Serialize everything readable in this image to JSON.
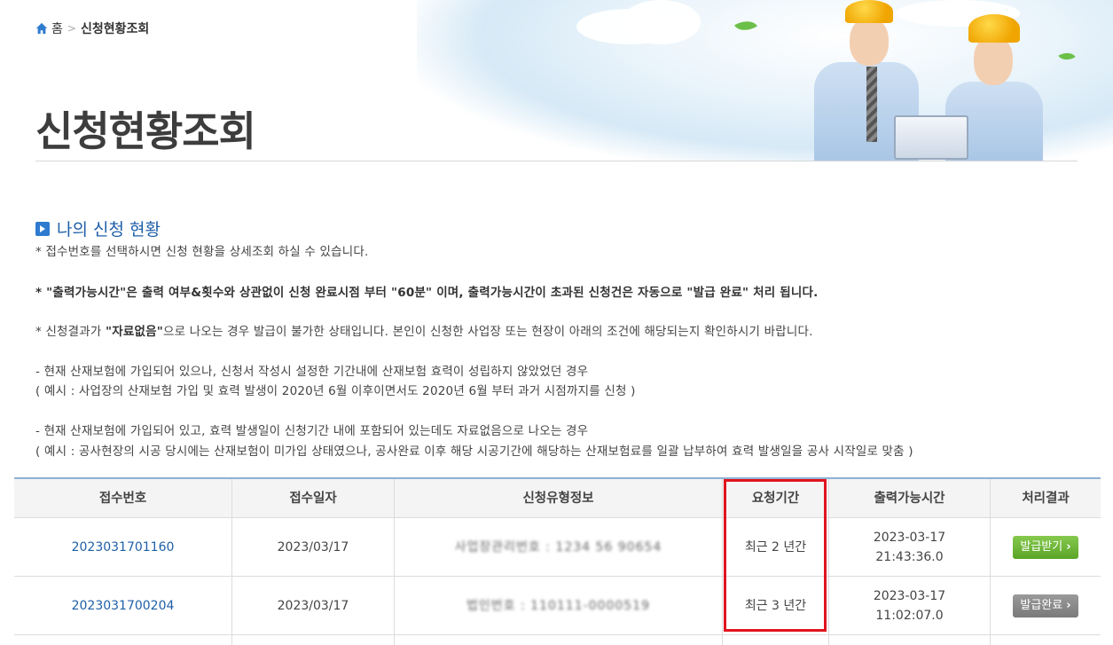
{
  "breadcrumb": {
    "home": "홈",
    "separator": ">",
    "current": "신청현황조회",
    "home_icon": "home-icon"
  },
  "page_title": "신청현황조회",
  "section": {
    "title": "나의 신청 현황",
    "notes": [
      "* 접수번호를 선택하시면 신청 현황을 상세조회 하실 수 있습니다.",
      "* \"출력가능시간\"은 출력 여부&횟수와 상관없이 신청 완료시점 부터 \"60분\" 이며, 출력가능시간이 초과된 신청건은 자동으로 \"발급 완료\" 처리 됩니다.",
      "* 신청결과가 ",
      "\"자료없음\"",
      "으로 나오는 경우 발급이 불가한 상태입니다. 본인이 신청한 사업장 또는 현장이 아래의 조건에 해당되는지 확인하시기 바랍니다.",
      "- 현재 산재보험에 가입되어 있으나, 신청서 작성시 설정한 기간내에 산재보험 효력이 성립하지 않았었던 경우",
      "( 예시 : 사업장의 산재보험 가입 및 효력 발생이 2020년 6월 이후이면서도 2020년 6월 부터 과거 시점까지를 신청 )",
      "- 현재 산재보험에 가입되어 있고, 효력 발생일이 신청기간 내에 포함되어 있는데도 자료없음으로 나오는 경우",
      "( 예시 : 공사현장의 시공 당시에는 산재보험이 미가입 상태였으나, 공사완료 이후 해당 시공기간에 해당하는 산재보험료를 일괄 납부하여 효력 발생일을 공사 시작일로 맞춤 )"
    ]
  },
  "table": {
    "headers": [
      "접수번호",
      "접수일자",
      "신청유형정보",
      "요청기간",
      "출력가능시간",
      "처리결과"
    ],
    "rows": [
      {
        "receipt_no": "2023031701160",
        "date": "2023/03/17",
        "type_info": "사업장관리번호 : 1234 56 90654",
        "period": "최근 2 년간",
        "time_date": "2023-03-17",
        "time_clock": "21:43:36.0",
        "result": "발급받기",
        "result_color": "#6cb73a"
      },
      {
        "receipt_no": "2023031700204",
        "date": "2023/03/17",
        "type_info": "법인번호 : 110111-0000519",
        "period": "최근 3 년간",
        "time_date": "2023-03-17",
        "time_clock": "11:02:07.0",
        "result": "발급완료",
        "result_color": "#8a8a8a"
      }
    ]
  },
  "colors": {
    "highlight": "#e1141e",
    "link": "#1f5fa8",
    "title": "#3d3d3d"
  }
}
